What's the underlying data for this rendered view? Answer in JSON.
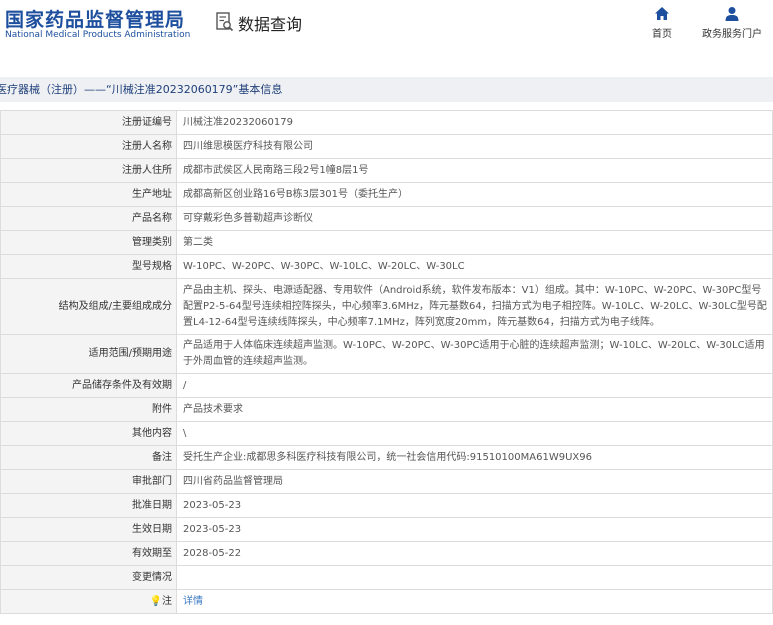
{
  "header": {
    "logo_cn": "国家药品监督管理局",
    "logo_en": "National Medical Products Administration",
    "query_title": "数据查询",
    "nav": [
      {
        "label": "首页",
        "icon": "home-icon"
      },
      {
        "label": "政务服务门户",
        "icon": "user-icon"
      }
    ],
    "brand_color": "#1d4f9e"
  },
  "breadcrumb": "医疗器械（注册）——“川械注准20232060179”基本信息",
  "rows": [
    {
      "label": "注册证编号",
      "value": "川械注准20232060179"
    },
    {
      "label": "注册人名称",
      "value": "四川维思模医疗科技有限公司"
    },
    {
      "label": "注册人住所",
      "value": "成都市武侯区人民南路三段2号1幢8层1号"
    },
    {
      "label": "生产地址",
      "value": "成都高新区创业路16号B栋3层301号（委托生产）"
    },
    {
      "label": "产品名称",
      "value": "可穿戴彩色多普勒超声诊断仪"
    },
    {
      "label": "管理类别",
      "value": "第二类"
    },
    {
      "label": "型号规格",
      "value": "W-10PC、W-20PC、W-30PC、W-10LC、W-20LC、W-30LC"
    },
    {
      "label": "结构及组成/主要组成成分",
      "value": "产品由主机、探头、电源适配器、专用软件（Android系统，软件发布版本：V1）组成。其中：W-10PC、W-20PC、W-30PC型号配置P2-5-64型号连续相控阵探头，中心频率3.6MHz，阵元基数64，扫描方式为电子相控阵。W-10LC、W-20LC、W-30LC型号配置L4-12-64型号连续线阵探头，中心频率7.1MHz，阵列宽度20mm，阵元基数64，扫描方式为电子线阵。"
    },
    {
      "label": "适用范围/预期用途",
      "value": "产品适用于人体临床连续超声监测。W-10PC、W-20PC、W-30PC适用于心脏的连续超声监测；W-10LC、W-20LC、W-30LC适用于外周血管的连续超声监测。"
    },
    {
      "label": "产品储存条件及有效期",
      "value": "/"
    },
    {
      "label": "附件",
      "value": "产品技术要求"
    },
    {
      "label": "其他内容",
      "value": "\\"
    },
    {
      "label": "备注",
      "value": "受托生产企业:成都思多科医疗科技有限公司，统一社会信用代码:91510100MA61W9UX96"
    },
    {
      "label": "审批部门",
      "value": "四川省药品监督管理局"
    },
    {
      "label": "批准日期",
      "value": "2023-05-23"
    },
    {
      "label": "生效日期",
      "value": "2023-05-23"
    },
    {
      "label": "有效期至",
      "value": "2028-05-22"
    },
    {
      "label": "变更情况",
      "value": ""
    }
  ],
  "note": {
    "label": "注",
    "bulb": "💡",
    "link": "详情"
  }
}
